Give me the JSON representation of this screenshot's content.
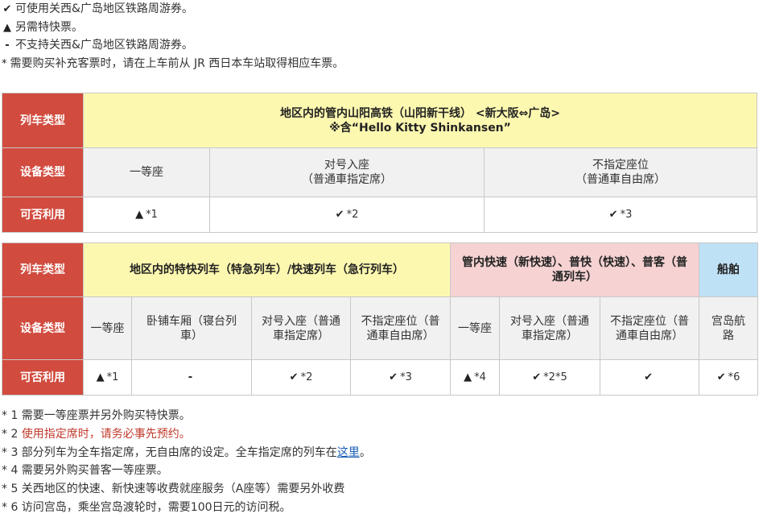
{
  "legend": [
    {
      "symbol": "✔",
      "icon": "check-icon",
      "text": "可使用关西&广岛地区铁路周游券。"
    },
    {
      "symbol": "▲",
      "icon": "triangle-icon",
      "text": "另需特快票。"
    },
    {
      "symbol": "-",
      "icon": "dash-icon",
      "text": "不支持关西&广岛地区铁路周游券。"
    },
    {
      "symbol": "*",
      "icon": "asterisk-icon",
      "text": "需要购买补充客票时，请在上车前从 JR 西日本车站取得相应车票。"
    }
  ],
  "colors": {
    "header": "#d14b3f",
    "yellow": "#fdf8b0",
    "pink": "#f6d2d2",
    "blue": "#bfe1f6",
    "gray": "#f1f1f1",
    "link": "#1a5fb4",
    "red_note": "#c0392b"
  },
  "table1": {
    "row_labels": {
      "train_type": "列车类型",
      "seat_type": "设备类型",
      "availability": "可否利用"
    },
    "train_title": "地区内的管内山阳高铁（山阳新干线） <新大阪⇔广岛>",
    "train_subtitle": "※含“Hello Kitty Shinkansen”",
    "seats": [
      {
        "line1": "一等座",
        "line2": ""
      },
      {
        "line1": "对号入座",
        "line2": "（普通車指定席）"
      },
      {
        "line1": "不指定座位",
        "line2": "（普通車自由席）"
      }
    ],
    "avail": [
      {
        "mark": "▲",
        "mark_icon": "triangle-icon",
        "note": "*1"
      },
      {
        "mark": "✔",
        "mark_icon": "check-icon",
        "note": "*2"
      },
      {
        "mark": "✔",
        "mark_icon": "check-icon",
        "note": "*3"
      }
    ]
  },
  "table2": {
    "row_labels": {
      "train_type": "列车类型",
      "seat_type": "设备类型",
      "availability": "可否利用"
    },
    "groups": {
      "limited": "地区内的特快列车（特急列车）/快速列车（急行列车）",
      "local": "管内快速（新快速）、普快（快速）、普客（普通列车）",
      "ferry": "船舶"
    },
    "seats": [
      "一等座",
      "卧铺车厢（寝台列車）",
      "对号入座（普通車指定席）",
      "不指定座位（普通車自由席）",
      "一等座",
      "对号入座（普通車指定席）",
      "不指定座位（普通車自由席）",
      "宫岛航路"
    ],
    "avail": [
      {
        "mark": "▲",
        "mark_icon": "triangle-icon",
        "note": "*1"
      },
      {
        "mark": "-",
        "mark_icon": "dash-icon",
        "note": ""
      },
      {
        "mark": "✔",
        "mark_icon": "check-icon",
        "note": "*2"
      },
      {
        "mark": "✔",
        "mark_icon": "check-icon",
        "note": "*3"
      },
      {
        "mark": "▲",
        "mark_icon": "triangle-icon",
        "note": "*4"
      },
      {
        "mark": "✔",
        "mark_icon": "check-icon",
        "note": "*2*5"
      },
      {
        "mark": "✔",
        "mark_icon": "check-icon",
        "note": ""
      },
      {
        "mark": "✔",
        "mark_icon": "check-icon",
        "note": "*6"
      }
    ]
  },
  "footnotes": {
    "n1": "* 1 需要一等座票并另外购买特快票。",
    "n2_prefix": "* 2 ",
    "n2_red": "使用指定席时，请务必事先预约。",
    "n3_prefix": "* 3 部分列车为全车指定席，无自由席的设定。全车指定席的列车在",
    "n3_link": "这里",
    "n3_suffix": "。",
    "n4": "* 4 需要另外购买普客一等座票。",
    "n5": "* 5 关西地区的快速、新快速等收费就座服务（A座等）需要另外收费",
    "n6": "* 6 访问宫岛，乘坐宫岛渡轮时，需要100日元的访问税。"
  }
}
